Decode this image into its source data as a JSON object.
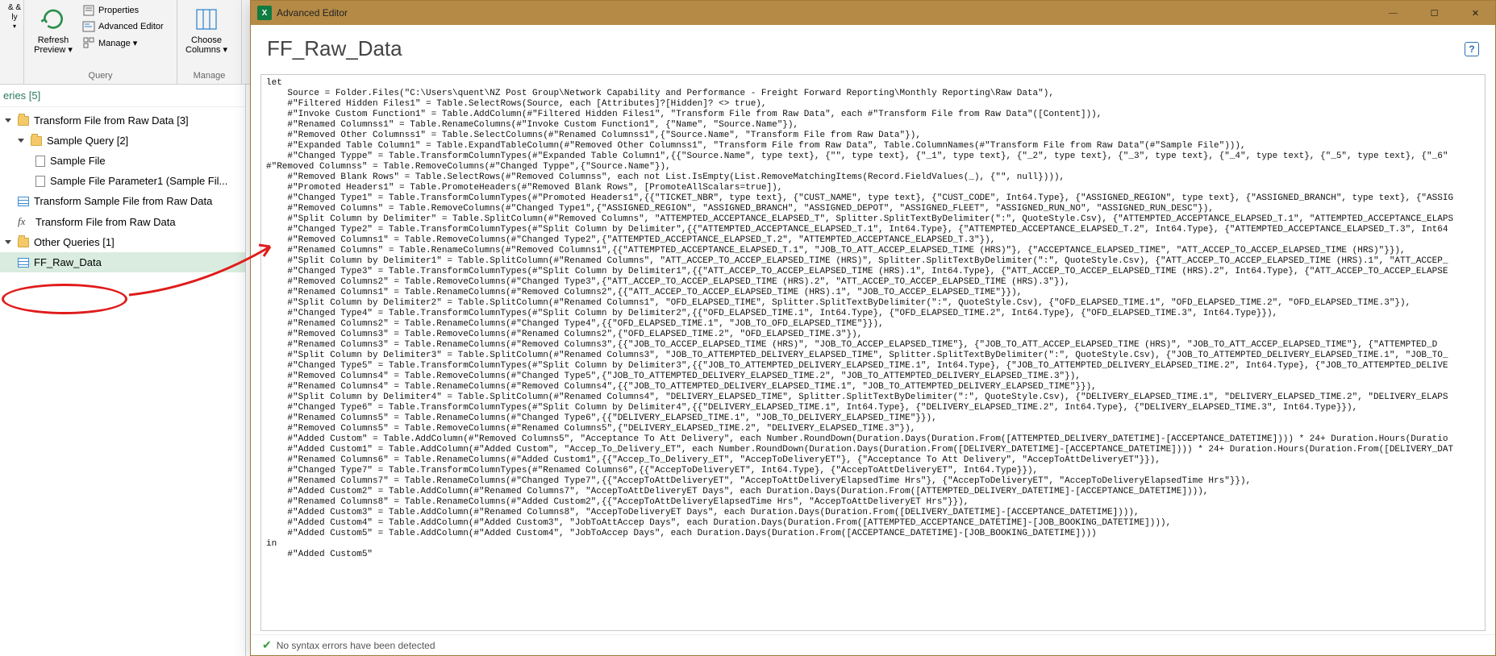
{
  "ribbon": {
    "close_apply": "& &\nly ",
    "refresh": "Refresh\nPreview ▾",
    "properties": "Properties",
    "advanced_editor": "Advanced Editor",
    "manage": "Manage ▾",
    "group_query": "Query",
    "choose_columns": "Choose\nColumns ▾",
    "group_manage": "Manage"
  },
  "queries": {
    "header": "eries [5]",
    "items": [
      {
        "type": "folder",
        "label": "Transform File from Raw Data [3]",
        "indent": 0
      },
      {
        "type": "folder",
        "label": "Sample Query [2]",
        "indent": 1
      },
      {
        "type": "doc",
        "label": "Sample File",
        "indent": 2
      },
      {
        "type": "param",
        "label": "Sample File Parameter1 (Sample Fil...",
        "indent": 2
      },
      {
        "type": "table",
        "label": "Transform Sample File from Raw Data",
        "indent": 1
      },
      {
        "type": "fx",
        "label": "Transform File from Raw Data",
        "indent": 1
      },
      {
        "type": "folder",
        "label": "Other Queries [1]",
        "indent": 0
      },
      {
        "type": "table",
        "label": "FF_Raw_Data",
        "indent": 1,
        "selected": true
      }
    ]
  },
  "editor": {
    "window_title": "Advanced Editor",
    "query_name": "FF_Raw_Data",
    "status": "No syntax errors have been detected",
    "code": "let\n    Source = Folder.Files(\"C:\\Users\\quent\\NZ Post Group\\Network Capability and Performance - Freight Forward Reporting\\Monthly Reporting\\Raw Data\"),\n    #\"Filtered Hidden Files1\" = Table.SelectRows(Source, each [Attributes]?[Hidden]? <> true),\n    #\"Invoke Custom Function1\" = Table.AddColumn(#\"Filtered Hidden Files1\", \"Transform File from Raw Data\", each #\"Transform File from Raw Data\"([Content])),\n    #\"Renamed Columnss1\" = Table.RenameColumns(#\"Invoke Custom Function1\", {\"Name\", \"Source.Name\"}),\n    #\"Removed Other Columnss1\" = Table.SelectColumns(#\"Renamed Columnss1\",{\"Source.Name\", \"Transform File from Raw Data\"}),\n    #\"Expanded Table Column1\" = Table.ExpandTableColumn(#\"Removed Other Columnss1\", \"Transform File from Raw Data\", Table.ColumnNames(#\"Transform File from Raw Data\"(#\"Sample File\"))),\n    #\"Changed Typpe\" = Table.TransformColumnTypes(#\"Expanded Table Column1\",{{\"Source.Name\", type text}, {\"\", type text}, {\"_1\", type text}, {\"_2\", type text}, {\"_3\", type text}, {\"_4\", type text}, {\"_5\", type text}, {\"_6\"\n#\"Removed Columnss\" = Table.RemoveColumns(#\"Changed Typpe\",{\"Source.Name\"}),\n    #\"Removed Blank Rows\" = Table.SelectRows(#\"Removed Columnss\", each not List.IsEmpty(List.RemoveMatchingItems(Record.FieldValues(_), {\"\", null}))),\n    #\"Promoted Headers1\" = Table.PromoteHeaders(#\"Removed Blank Rows\", [PromoteAllScalars=true]),\n    #\"Changed Type1\" = Table.TransformColumnTypes(#\"Promoted Headers1\",{{\"TICKET_NBR\", type text}, {\"CUST_NAME\", type text}, {\"CUST_CODE\", Int64.Type}, {\"ASSIGNED_REGION\", type text}, {\"ASSIGNED_BRANCH\", type text}, {\"ASSIG\n    #\"Removed Columns\" = Table.RemoveColumns(#\"Changed Type1\",{\"ASSIGNED_REGION\", \"ASSIGNED_BRANCH\", \"ASSIGNED_DEPOT\", \"ASSIGNED_FLEET\", \"ASSIGNED_RUN_NO\", \"ASSIGNED_RUN_DESC\"}),\n    #\"Split Column by Delimiter\" = Table.SplitColumn(#\"Removed Columns\", \"ATTEMPTED_ACCEPTANCE_ELAPSED_T\", Splitter.SplitTextByDelimiter(\":\", QuoteStyle.Csv), {\"ATTEMPTED_ACCEPTANCE_ELAPSED_T.1\", \"ATTEMPTED_ACCEPTANCE_ELAPS\n    #\"Changed Type2\" = Table.TransformColumnTypes(#\"Split Column by Delimiter\",{{\"ATTEMPTED_ACCEPTANCE_ELAPSED_T.1\", Int64.Type}, {\"ATTEMPTED_ACCEPTANCE_ELAPSED_T.2\", Int64.Type}, {\"ATTEMPTED_ACCEPTANCE_ELAPSED_T.3\", Int64\n    #\"Removed Columns1\" = Table.RemoveColumns(#\"Changed Type2\",{\"ATTEMPTED_ACCEPTANCE_ELAPSED_T.2\", \"ATTEMPTED_ACCEPTANCE_ELAPSED_T.3\"}),\n    #\"Renamed Columns\" = Table.RenameColumns(#\"Removed Columns1\",{{\"ATTEMPTED_ACCEPTANCE_ELAPSED_T.1\", \"JOB_TO_ATT_ACCEP_ELAPSED_TIME (HRS)\"}, {\"ACCEPTANCE_ELAPSED_TIME\", \"ATT_ACCEP_TO_ACCEP_ELAPSED_TIME (HRS)\"}}),\n    #\"Split Column by Delimiter1\" = Table.SplitColumn(#\"Renamed Columns\", \"ATT_ACCEP_TO_ACCEP_ELAPSED_TIME (HRS)\", Splitter.SplitTextByDelimiter(\":\", QuoteStyle.Csv), {\"ATT_ACCEP_TO_ACCEP_ELAPSED_TIME (HRS).1\", \"ATT_ACCEP_\n    #\"Changed Type3\" = Table.TransformColumnTypes(#\"Split Column by Delimiter1\",{{\"ATT_ACCEP_TO_ACCEP_ELAPSED_TIME (HRS).1\", Int64.Type}, {\"ATT_ACCEP_TO_ACCEP_ELAPSED_TIME (HRS).2\", Int64.Type}, {\"ATT_ACCEP_TO_ACCEP_ELAPSE\n    #\"Removed Columns2\" = Table.RemoveColumns(#\"Changed Type3\",{\"ATT_ACCEP_TO_ACCEP_ELAPSED_TIME (HRS).2\", \"ATT_ACCEP_TO_ACCEP_ELAPSED_TIME (HRS).3\"}),\n    #\"Renamed Columns1\" = Table.RenameColumns(#\"Removed Columns2\",{{\"ATT_ACCEP_TO_ACCEP_ELAPSED_TIME (HRS).1\", \"JOB_TO_ACCEP_ELAPSED_TIME\"}}),\n    #\"Split Column by Delimiter2\" = Table.SplitColumn(#\"Renamed Columns1\", \"OFD_ELAPSED_TIME\", Splitter.SplitTextByDelimiter(\":\", QuoteStyle.Csv), {\"OFD_ELAPSED_TIME.1\", \"OFD_ELAPSED_TIME.2\", \"OFD_ELAPSED_TIME.3\"}),\n    #\"Changed Type4\" = Table.TransformColumnTypes(#\"Split Column by Delimiter2\",{{\"OFD_ELAPSED_TIME.1\", Int64.Type}, {\"OFD_ELAPSED_TIME.2\", Int64.Type}, {\"OFD_ELAPSED_TIME.3\", Int64.Type}}),\n    #\"Renamed Columns2\" = Table.RenameColumns(#\"Changed Type4\",{{\"OFD_ELAPSED_TIME.1\", \"JOB_TO_OFD_ELAPSED_TIME\"}}),\n    #\"Removed Columns3\" = Table.RemoveColumns(#\"Renamed Columns2\",{\"OFD_ELAPSED_TIME.2\", \"OFD_ELAPSED_TIME.3\"}),\n    #\"Renamed Columns3\" = Table.RenameColumns(#\"Removed Columns3\",{{\"JOB_TO_ACCEP_ELAPSED_TIME (HRS)\", \"JOB_TO_ACCEP_ELAPSED_TIME\"}, {\"JOB_TO_ATT_ACCEP_ELAPSED_TIME (HRS)\", \"JOB_TO_ATT_ACCEP_ELAPSED_TIME\"}, {\"ATTEMPTED_D\n    #\"Split Column by Delimiter3\" = Table.SplitColumn(#\"Renamed Columns3\", \"JOB_TO_ATTEMPTED_DELIVERY_ELAPSED_TIME\", Splitter.SplitTextByDelimiter(\":\", QuoteStyle.Csv), {\"JOB_TO_ATTEMPTED_DELIVERY_ELAPSED_TIME.1\", \"JOB_TO_\n    #\"Changed Type5\" = Table.TransformColumnTypes(#\"Split Column by Delimiter3\",{{\"JOB_TO_ATTEMPTED_DELIVERY_ELAPSED_TIME.1\", Int64.Type}, {\"JOB_TO_ATTEMPTED_DELIVERY_ELAPSED_TIME.2\", Int64.Type}, {\"JOB_TO_ATTEMPTED_DELIVE\n    #\"Removed Columns4\" = Table.RemoveColumns(#\"Changed Type5\",{\"JOB_TO_ATTEMPTED_DELIVERY_ELAPSED_TIME.2\", \"JOB_TO_ATTEMPTED_DELIVERY_ELAPSED_TIME.3\"}),\n    #\"Renamed Columns4\" = Table.RenameColumns(#\"Removed Columns4\",{{\"JOB_TO_ATTEMPTED_DELIVERY_ELAPSED_TIME.1\", \"JOB_TO_ATTEMPTED_DELIVERY_ELAPSED_TIME\"}}),\n    #\"Split Column by Delimiter4\" = Table.SplitColumn(#\"Renamed Columns4\", \"DELIVERY_ELAPSED_TIME\", Splitter.SplitTextByDelimiter(\":\", QuoteStyle.Csv), {\"DELIVERY_ELAPSED_TIME.1\", \"DELIVERY_ELAPSED_TIME.2\", \"DELIVERY_ELAPS\n    #\"Changed Type6\" = Table.TransformColumnTypes(#\"Split Column by Delimiter4\",{{\"DELIVERY_ELAPSED_TIME.1\", Int64.Type}, {\"DELIVERY_ELAPSED_TIME.2\", Int64.Type}, {\"DELIVERY_ELAPSED_TIME.3\", Int64.Type}}),\n    #\"Renamed Columns5\" = Table.RenameColumns(#\"Changed Type6\",{{\"DELIVERY_ELAPSED_TIME.1\", \"JOB_TO_DELIVERY_ELAPSED_TIME\"}}),\n    #\"Removed Columns5\" = Table.RemoveColumns(#\"Renamed Columns5\",{\"DELIVERY_ELAPSED_TIME.2\", \"DELIVERY_ELAPSED_TIME.3\"}),\n    #\"Added Custom\" = Table.AddColumn(#\"Removed Columns5\", \"Acceptance To Att Delivery\", each Number.RoundDown(Duration.Days(Duration.From([ATTEMPTED_DELIVERY_DATETIME]-[ACCEPTANCE_DATETIME]))) * 24+ Duration.Hours(Duratio\n    #\"Added Custom1\" = Table.AddColumn(#\"Added Custom\", \"Accep_To_Delivery_ET\", each Number.RoundDown(Duration.Days(Duration.From([DELIVERY_DATETIME]-[ACCEPTANCE_DATETIME]))) * 24+ Duration.Hours(Duration.From([DELIVERY_DAT\n    #\"Renamed Columns6\" = Table.RenameColumns(#\"Added Custom1\",{{\"Accep_To_Delivery_ET\", \"AccepToDeliveryET\"}, {\"Acceptance To Att Delivery\", \"AccepToAttDeliveryET\"}}),\n    #\"Changed Type7\" = Table.TransformColumnTypes(#\"Renamed Columns6\",{{\"AccepToDeliveryET\", Int64.Type}, {\"AccepToAttDeliveryET\", Int64.Type}}),\n    #\"Renamed Columns7\" = Table.RenameColumns(#\"Changed Type7\",{{\"AccepToAttDeliveryET\", \"AccepToAttDeliveryElapsedTime Hrs\"}, {\"AccepToDeliveryET\", \"AccepToDeliveryElapsedTime Hrs\"}}),\n    #\"Added Custom2\" = Table.AddColumn(#\"Renamed Columns7\", \"AccepToAttDeliveryET Days\", each Duration.Days(Duration.From([ATTEMPTED_DELIVERY_DATETIME]-[ACCEPTANCE_DATETIME]))),\n    #\"Renamed Columns8\" = Table.RenameColumns(#\"Added Custom2\",{{\"AccepToAttDeliveryElapsedTime Hrs\", \"AccepToAttDeliveryET Hrs\"}}),\n    #\"Added Custom3\" = Table.AddColumn(#\"Renamed Columns8\", \"AccepToDeliveryET Days\", each Duration.Days(Duration.From([DELIVERY_DATETIME]-[ACCEPTANCE_DATETIME]))),\n    #\"Added Custom4\" = Table.AddColumn(#\"Added Custom3\", \"JobToAttAccep Days\", each Duration.Days(Duration.From([ATTEMPTED_ACCEPTANCE_DATETIME]-[JOB_BOOKING_DATETIME]))),\n    #\"Added Custom5\" = Table.AddColumn(#\"Added Custom4\", \"JobToAccep Days\", each Duration.Days(Duration.From([ACCEPTANCE_DATETIME]-[JOB_BOOKING_DATETIME])))\nin\n    #\"Added Custom5\""
  }
}
